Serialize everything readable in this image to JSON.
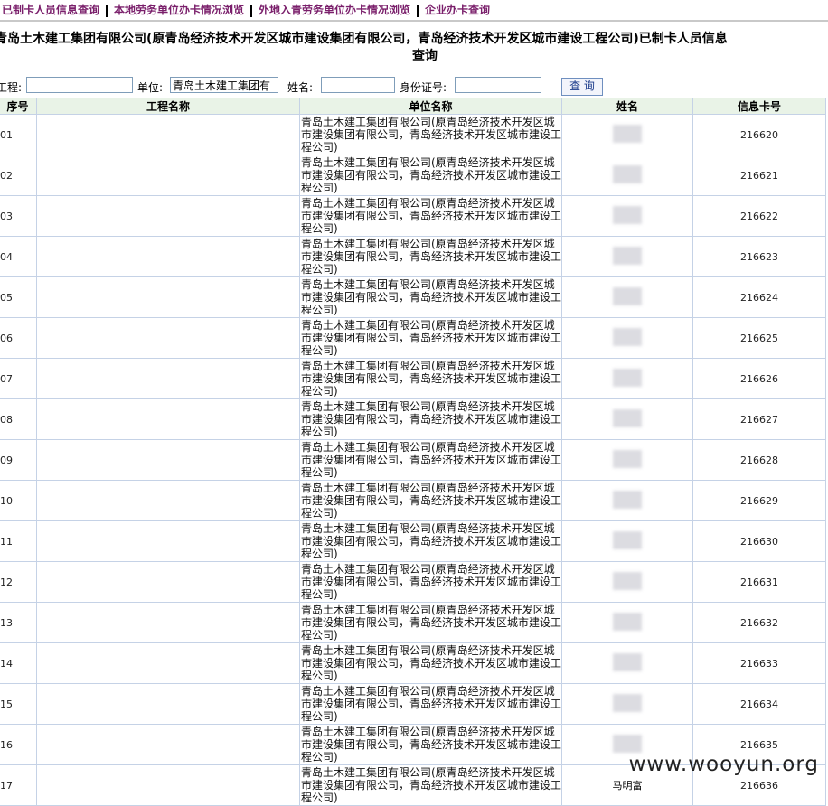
{
  "nav": {
    "tabs": [
      "已制卡人员信息查询",
      "本地劳务单位办卡情况浏览",
      "外地入青劳务单位办卡情况浏览",
      "企业办卡查询"
    ]
  },
  "page_title": "青岛土木建工集团有限公司(原青岛经济技术开发区城市建设集团有限公司，青岛经济技术开发区城市建设工程公司)已制卡人员信息查询",
  "search": {
    "project_label": "工程:",
    "project_value": "",
    "unit_label": "单位:",
    "unit_value": "青岛土木建工集团有",
    "name_label": "姓名:",
    "name_value": "",
    "id_label": "身份证号:",
    "id_value": "",
    "query_button": "查 询"
  },
  "table": {
    "headers": [
      "序号",
      "工程名称",
      "单位名称",
      "姓名",
      "信息卡号"
    ],
    "unit_name": "青岛土木建工集团有限公司(原青岛经济技术开发区城市建设集团有限公司，青岛经济技术开发区城市建设工程公司)",
    "rows": [
      {
        "no": "01",
        "name_hint": "",
        "card": "216620"
      },
      {
        "no": "02",
        "name_hint": "",
        "card": "216621"
      },
      {
        "no": "03",
        "name_hint": "",
        "card": "216622"
      },
      {
        "no": "04",
        "name_hint": "",
        "card": "216623"
      },
      {
        "no": "05",
        "name_hint": "",
        "card": "216624"
      },
      {
        "no": "06",
        "name_hint": "",
        "card": "216625"
      },
      {
        "no": "07",
        "name_hint": "",
        "card": "216626"
      },
      {
        "no": "08",
        "name_hint": "",
        "card": "216627"
      },
      {
        "no": "09",
        "name_hint": "",
        "card": "216628"
      },
      {
        "no": "10",
        "name_hint": "",
        "card": "216629"
      },
      {
        "no": "11",
        "name_hint": "",
        "card": "216630"
      },
      {
        "no": "12",
        "name_hint": "",
        "card": "216631"
      },
      {
        "no": "13",
        "name_hint": "",
        "card": "216632"
      },
      {
        "no": "14",
        "name_hint": "",
        "card": "216633"
      },
      {
        "no": "15",
        "name_hint": "",
        "card": "216634"
      },
      {
        "no": "16",
        "name_hint": "",
        "card": "216635"
      },
      {
        "no": "17",
        "name_hint": "马明富",
        "card": "216636"
      }
    ]
  },
  "watermark": "www.wooyun.org"
}
